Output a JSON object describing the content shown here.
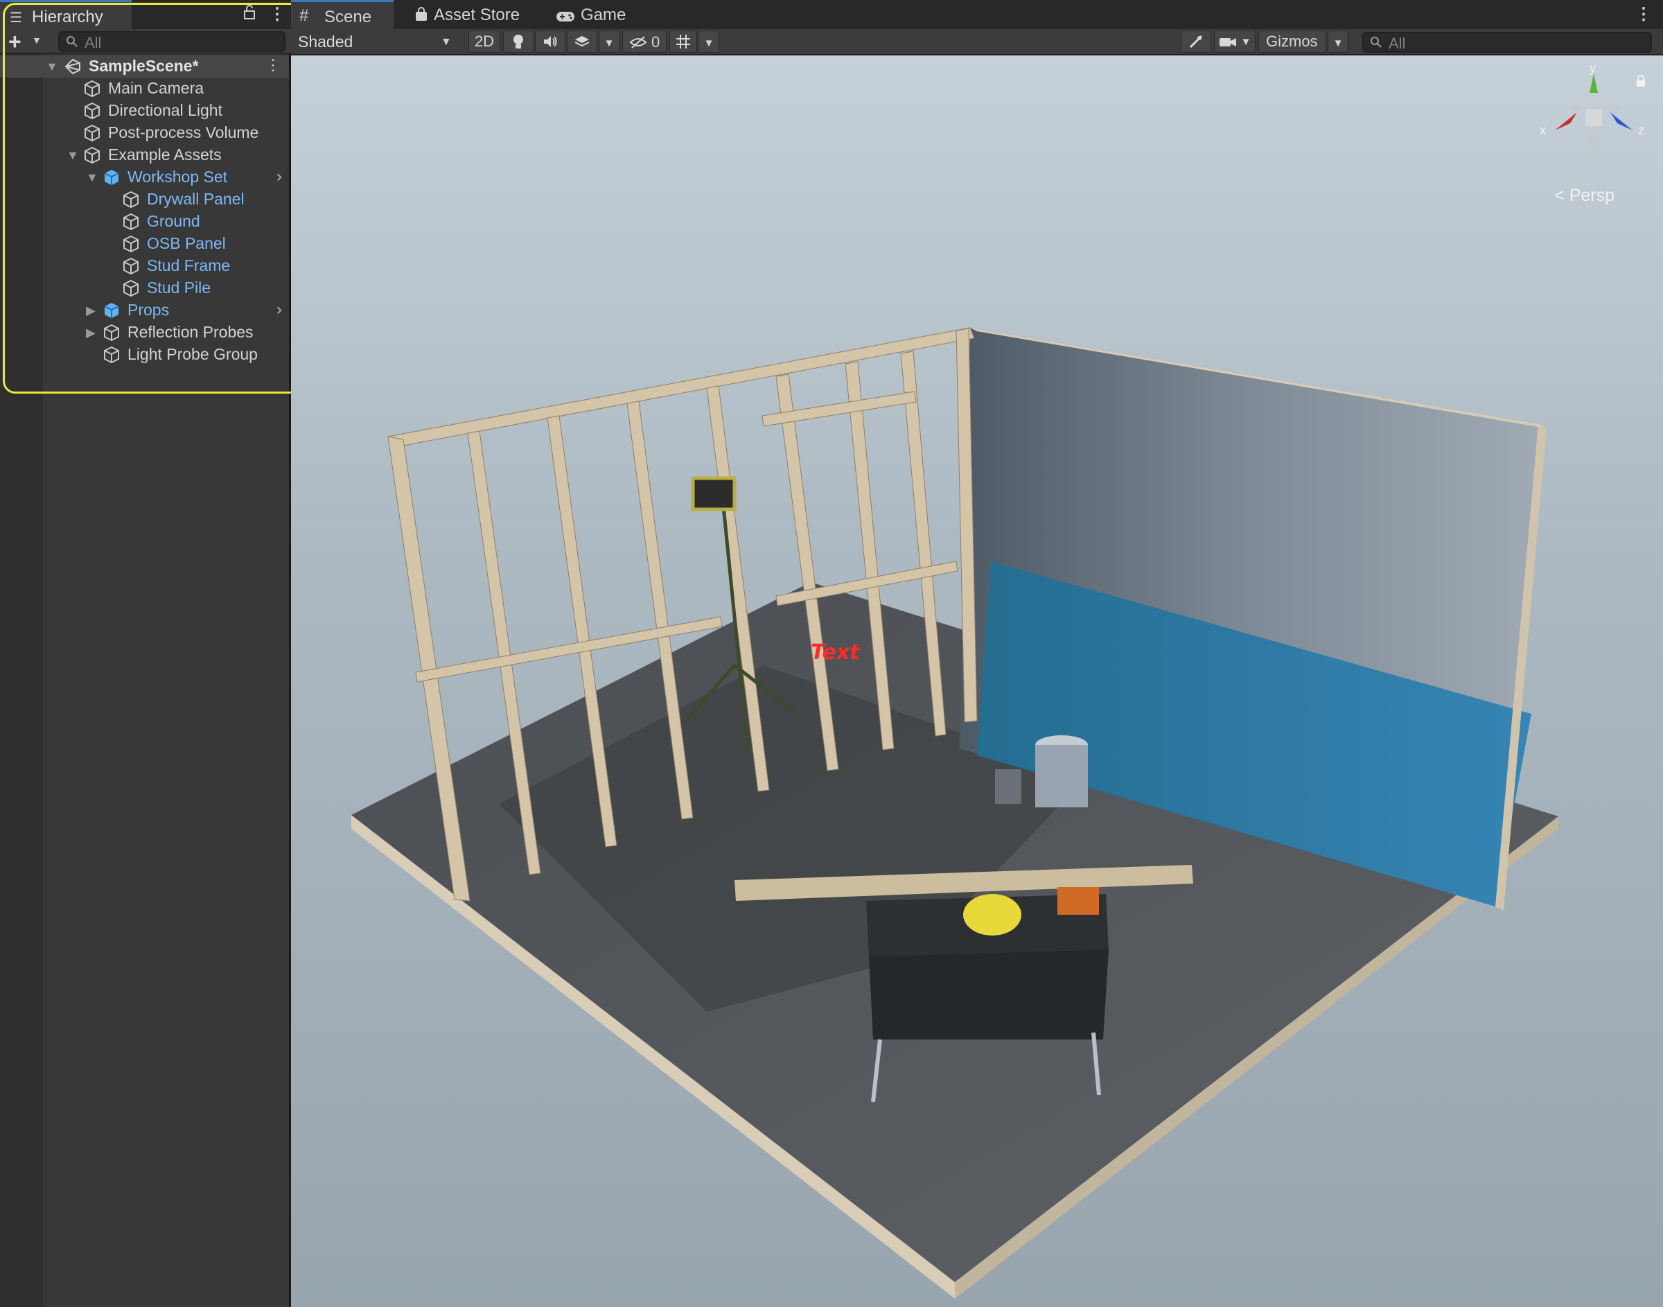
{
  "hierarchy": {
    "title": "Hierarchy",
    "search_placeholder": "All",
    "scene_name": "SampleScene*",
    "items": [
      {
        "label": "Main Camera"
      },
      {
        "label": "Directional Light"
      },
      {
        "label": "Post-process Volume"
      },
      {
        "label": "Example Assets"
      },
      {
        "label": "Workshop Set"
      },
      {
        "label": "Drywall Panel"
      },
      {
        "label": "Ground"
      },
      {
        "label": "OSB Panel"
      },
      {
        "label": "Stud Frame"
      },
      {
        "label": "Stud Pile"
      },
      {
        "label": "Props"
      },
      {
        "label": "Reflection Probes"
      },
      {
        "label": "Light Probe Group"
      }
    ]
  },
  "scene_tabs": {
    "scene": "Scene",
    "asset_store": "Asset Store",
    "game": "Game"
  },
  "scene_toolbar": {
    "draw_mode": "Shaded",
    "mode_2d": "2D",
    "hidden_count": "0",
    "gizmos": "Gizmos",
    "search_placeholder": "All"
  },
  "viewport": {
    "projection": "Persp",
    "axis_x": "x",
    "axis_y": "y",
    "axis_z": "z",
    "world_text": "Text"
  },
  "colors": {
    "accent_blue": "#3a79bb",
    "prefab_text": "#7cb8f6",
    "highlight": "#e8e842",
    "gizmo_x": "#c8312b",
    "gizmo_y": "#5ab53c",
    "gizmo_z": "#2f5ad2"
  }
}
